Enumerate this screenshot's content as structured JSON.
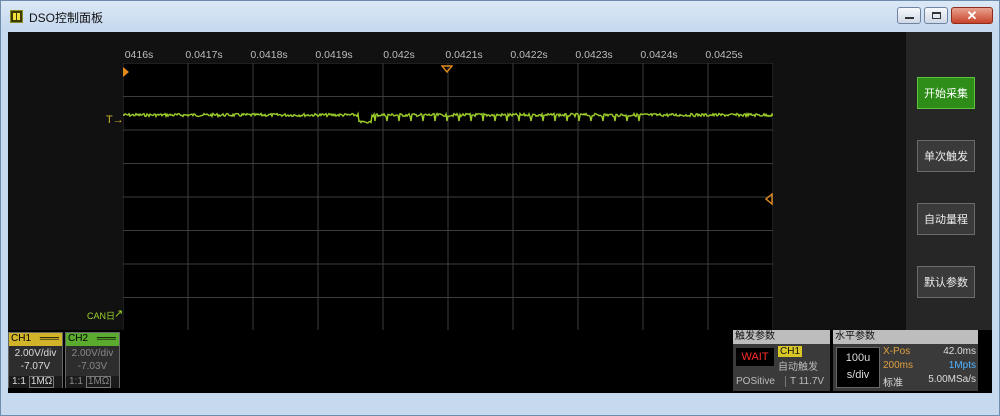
{
  "window": {
    "title": "DSO控制面板"
  },
  "toolbar": {
    "buttons": [
      {
        "label": "开始采集",
        "primary": true
      },
      {
        "label": "单次触发",
        "primary": false
      },
      {
        "label": "自动量程",
        "primary": false
      },
      {
        "label": "默认参数",
        "primary": false
      }
    ]
  },
  "scope": {
    "time_ticks": [
      "0416s",
      "0.0417s",
      "0.0418s",
      "0.0419s",
      "0.042s",
      "0.0421s",
      "0.0422s",
      "0.0423s",
      "0.0424s",
      "0.0425s"
    ],
    "trigger_level_marker": "T→",
    "channel_marker_label": "CAN日",
    "colors": {
      "trace": "#9ccc2a",
      "ch1": "#d2b42a",
      "ch2": "#5aab2e",
      "grid": "#3c3c3c"
    }
  },
  "channels": [
    {
      "name": "CH1",
      "coupling": "DC",
      "vdiv": "2.00V/div",
      "offset": "-7.07V",
      "probe": "1:1",
      "impedance": "1MΩ"
    },
    {
      "name": "CH2",
      "coupling": "DC",
      "vdiv": "2.00V/div",
      "offset": "-7.03V",
      "probe": "1:1",
      "impedance": "1MΩ"
    }
  ],
  "trigger": {
    "title": "触发参数",
    "status": "WAIT",
    "source": "CH1",
    "mode": "自动触发",
    "slope": "POSitive",
    "level": "T 11.7V"
  },
  "horizontal": {
    "title": "水平参数",
    "tdiv_value": "100u",
    "tdiv_unit": "s/div",
    "xpos_label": "X-Pos",
    "xpos_value": "42.0ms",
    "record_time": "200ms",
    "record_points": "1Mpts",
    "mode": "标准",
    "sample_rate": "5.00MSa/s"
  }
}
